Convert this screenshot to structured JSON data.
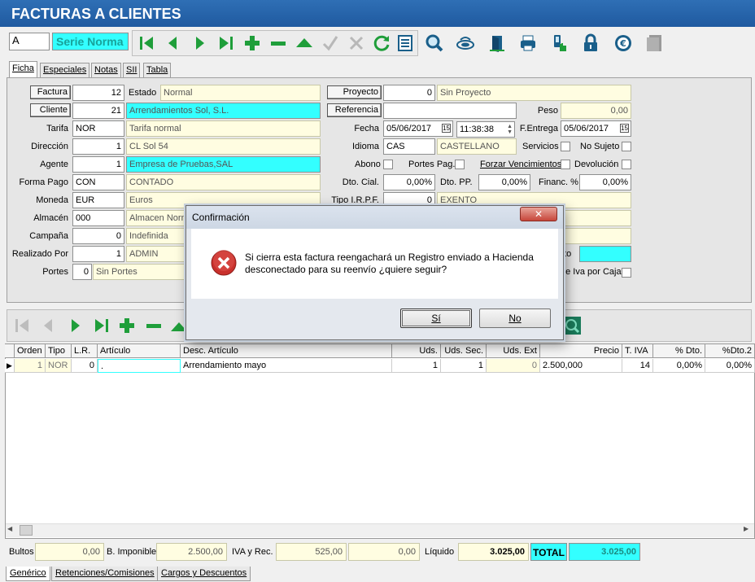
{
  "window": {
    "title": "FACTURAS A CLIENTES"
  },
  "toolbar": {
    "serie_code": "A",
    "serie_label": "Serie Norma"
  },
  "tabs": [
    "Ficha",
    "Especiales",
    "Notas",
    "SII",
    "Tabla"
  ],
  "form": {
    "factura_label": "Factura",
    "factura_value": "12",
    "estado_label": "Estado",
    "estado_value": "Normal",
    "proyecto_label": "Proyecto",
    "proyecto_value": "0",
    "proyecto_desc": "Sin Proyecto",
    "cliente_label": "Cliente",
    "cliente_value": "21",
    "cliente_name": "Arrendamientos Sol, S.L.",
    "referencia_label": "Referencia",
    "referencia_value": "",
    "peso_label": "Peso",
    "peso_value": "0,00",
    "tarifa_label": "Tarifa",
    "tarifa_code": "NOR",
    "tarifa_desc": "Tarifa normal",
    "fecha_label": "Fecha",
    "fecha_value": "05/06/2017",
    "hora_value": "11:38:38",
    "fentrega_label": "F.Entrega",
    "fentrega_value": "05/06/2017",
    "direccion_label": "Dirección",
    "direccion_value": "1",
    "direccion_desc": "CL  Sol 54",
    "idioma_label": "Idioma",
    "idioma_code": "CAS",
    "idioma_desc": "CASTELLANO",
    "servicios_label": "Servicios",
    "nosujeto_label": "No Sujeto",
    "agente_label": "Agente",
    "agente_value": "1",
    "agente_desc": "Empresa de Pruebas,SAL",
    "abono_label": "Abono",
    "portespag_label": "Portes Pag.",
    "forzar_label": "Forzar Vencimientos",
    "devolucion_label": "Devolución",
    "formapago_label": "Forma Pago",
    "formapago_code": "CON",
    "formapago_desc": "CONTADO",
    "dtocial_label": "Dto. Cial.",
    "dtocial_value": "0,00%",
    "dtopp_label": "Dto. PP.",
    "dtopp_value": "0,00%",
    "financ_label": "Financ. %",
    "financ_value": "0,00%",
    "moneda_label": "Moneda",
    "moneda_code": "EUR",
    "moneda_desc": "Euros",
    "tipoirpf_label": "Tipo I.R.P.F.",
    "tipoirpf_value": "0",
    "tipoirpf_desc": "EXENTO",
    "almacen_label": "Almacén",
    "almacen_code": "000",
    "almacen_desc": "Almacen Norm",
    "campana_label": "Campaña",
    "campana_value": "0",
    "campana_desc": "Indefinida",
    "realizado_label": "Realizado Por",
    "realizado_value": "1",
    "realizado_desc": "ADMIN",
    "portes_label": "Portes",
    "portes_value": "0",
    "portes_desc": "Sin Portes",
    "nto_fragment": "nto",
    "ivacaja_label": "de Iva por Caja"
  },
  "grid": {
    "headers": [
      "Orden",
      "Tipo",
      "L.R.",
      "Artículo",
      "Desc. Artículo",
      "Uds.",
      "Uds. Sec.",
      "Uds. Ext",
      "Precio",
      "T. IVA",
      "% Dto.",
      "%Dto.2"
    ],
    "rows": [
      [
        "1",
        "NOR",
        "0",
        ".",
        "Arrendamiento mayo",
        "1",
        "1",
        "0",
        "2.500,000",
        "14",
        "0,00%",
        "0,00%"
      ]
    ]
  },
  "footer": {
    "bultos_label": "Bultos",
    "bultos_value": "0,00",
    "bimponible_label": "B. Imponible",
    "bimponible_value": "2.500,00",
    "ivarec_label": "IVA y Rec.",
    "iva_value": "525,00",
    "rec_value": "0,00",
    "liquido_label": "Líquido",
    "liquido_value": "3.025,00",
    "total_label": "TOTAL",
    "total_value": "3.025,00"
  },
  "bottom_tabs": [
    "Genérico",
    "Retenciones/Comisiones",
    "Cargos y Descuentos"
  ],
  "dialog": {
    "title": "Confirmación",
    "message_line1": "Si cierra esta factura reengachará un Registro enviado a Hacienda",
    "message_line2": "desconectado para su reenvío ¿quiere seguir?",
    "yes_label": "Sí",
    "no_label": "No"
  },
  "colors": {
    "title_bar": "#1f5aa0",
    "highlight": "#33ffff",
    "readonly": "#fffde1",
    "toolbar_green": "#1f9e3a"
  }
}
